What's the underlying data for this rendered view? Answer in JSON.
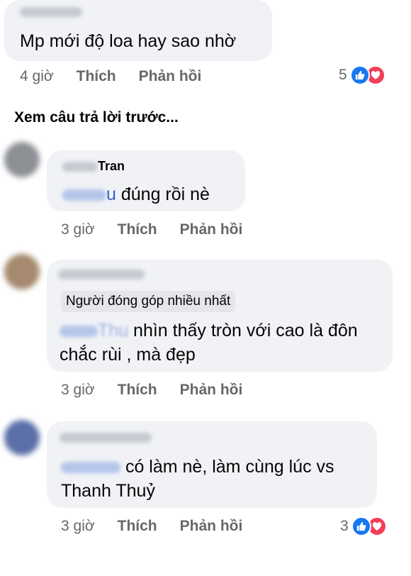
{
  "comment1": {
    "text": "Mp mới độ loa hay sao nhờ",
    "time": "4 giờ",
    "like": "Thích",
    "reply": "Phản hồi",
    "reaction_count": "5"
  },
  "view_previous": "Xem câu trả lời trước...",
  "comment2": {
    "name_tail": "Tran",
    "tag_tail": "u",
    "text": " đúng rồi nè",
    "time": "3 giờ",
    "like": "Thích",
    "reply": "Phản hồi"
  },
  "comment3": {
    "badge": "Người đóng góp nhiều nhất",
    "tag_tail": "Thu",
    "text_line1": " nhìn thấy tròn với cao là đôn",
    "text_line2": "chắc rùi , mà đẹp",
    "time": "3 giờ",
    "like": "Thích",
    "reply": "Phản hồi"
  },
  "comment4": {
    "text_line1": " có làm nè, làm cùng lúc vs",
    "text_line2": "Thanh Thuỷ",
    "time": "3 giờ",
    "like": "Thích",
    "reply": "Phản hồi",
    "reaction_count": "3"
  },
  "colors": {
    "bubble": "#f0f2f5",
    "meta": "#65676b",
    "like_blue": "#1877f2",
    "love_red": "#f33e58",
    "tag": "#3b5bd1"
  },
  "icons": [
    "like-icon",
    "love-icon"
  ]
}
